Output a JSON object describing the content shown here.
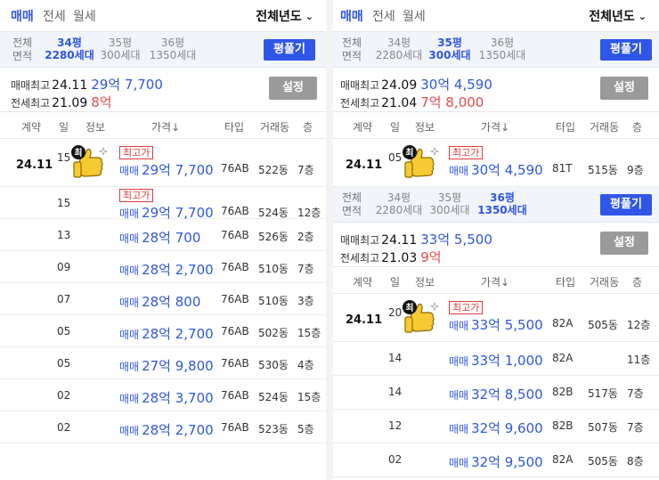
{
  "left": {
    "tabs": [
      "매매",
      "전세",
      "월세"
    ],
    "year_select": "전체년도",
    "size_labels": [
      "전체",
      "면적"
    ],
    "sizes": [
      {
        "pyeong": "34평",
        "units": "2280세대",
        "active": true
      },
      {
        "pyeong": "35평",
        "units": "300세대",
        "active": false
      },
      {
        "pyeong": "36평",
        "units": "1350세대",
        "active": false
      }
    ],
    "pyeong_button": "평풀기",
    "max_sale": {
      "label": "매매최고",
      "date": "24.11",
      "price": "29억 7,700"
    },
    "max_jeonse": {
      "label": "전세최고",
      "date": "21.09",
      "price": "8억"
    },
    "setting_button": "설정",
    "headers": [
      "계약",
      "일",
      "정보",
      "가격↓",
      "타입",
      "거래동",
      "층"
    ],
    "rows": [
      {
        "contract": "24.11",
        "day": "15",
        "badge": "최고가",
        "kind": "매매",
        "price": "29억 7,700",
        "type": "76AB",
        "dong": "522동",
        "floor": "7층"
      },
      {
        "contract": "",
        "day": "15",
        "badge": "최고가",
        "kind": "매매",
        "price": "29억 7,700",
        "type": "76AB",
        "dong": "524동",
        "floor": "12층"
      },
      {
        "contract": "",
        "day": "13",
        "badge": "",
        "kind": "매매",
        "price": "28억 700",
        "type": "76AB",
        "dong": "526동",
        "floor": "2층"
      },
      {
        "contract": "",
        "day": "09",
        "badge": "",
        "kind": "매매",
        "price": "28억 2,700",
        "type": "76AB",
        "dong": "510동",
        "floor": "7층"
      },
      {
        "contract": "",
        "day": "07",
        "badge": "",
        "kind": "매매",
        "price": "28억 800",
        "type": "76AB",
        "dong": "510동",
        "floor": "3층"
      },
      {
        "contract": "",
        "day": "05",
        "badge": "",
        "kind": "매매",
        "price": "28억 2,700",
        "type": "76AB",
        "dong": "502동",
        "floor": "15층"
      },
      {
        "contract": "",
        "day": "05",
        "badge": "",
        "kind": "매매",
        "price": "27억 9,800",
        "type": "76AB",
        "dong": "530동",
        "floor": "4층"
      },
      {
        "contract": "",
        "day": "02",
        "badge": "",
        "kind": "매매",
        "price": "28억 3,700",
        "type": "76AB",
        "dong": "524동",
        "floor": "15층"
      },
      {
        "contract": "",
        "day": "02",
        "badge": "",
        "kind": "매매",
        "price": "28억 2,700",
        "type": "76AB",
        "dong": "523동",
        "floor": "5층"
      }
    ]
  },
  "right": {
    "tabs": [
      "매매",
      "전세",
      "월세"
    ],
    "year_select": "전체년도",
    "top": {
      "size_labels": [
        "전체",
        "면적"
      ],
      "sizes": [
        {
          "pyeong": "34평",
          "units": "2280세대",
          "active": false
        },
        {
          "pyeong": "35평",
          "units": "300세대",
          "active": true
        },
        {
          "pyeong": "36평",
          "units": "1350세대",
          "active": false
        }
      ],
      "pyeong_button": "평풀기",
      "max_sale": {
        "label": "매매최고",
        "date": "24.09",
        "price": "30억 4,590"
      },
      "max_jeonse": {
        "label": "전세최고",
        "date": "21.04",
        "price": "7억 8,000"
      },
      "setting_button": "설정",
      "headers": [
        "계약",
        "일",
        "정보",
        "가격↓",
        "타입",
        "거래동",
        "층"
      ],
      "rows": [
        {
          "contract": "24.11",
          "day": "05",
          "badge": "최고가",
          "kind": "매매",
          "price": "30억 4,590",
          "type": "81T",
          "dong": "515동",
          "floor": "9층"
        }
      ]
    },
    "bottom": {
      "size_labels": [
        "전체",
        "면적"
      ],
      "sizes": [
        {
          "pyeong": "34평",
          "units": "2280세대",
          "active": false
        },
        {
          "pyeong": "35평",
          "units": "300세대",
          "active": false
        },
        {
          "pyeong": "36평",
          "units": "1350세대",
          "active": true
        }
      ],
      "pyeong_button": "평풀기",
      "max_sale": {
        "label": "매매최고",
        "date": "24.11",
        "price": "33억 5,500"
      },
      "max_jeonse": {
        "label": "전세최고",
        "date": "21.03",
        "price": "9억"
      },
      "setting_button": "설정",
      "headers": [
        "계약",
        "일",
        "정보",
        "가격↓",
        "타입",
        "거래동",
        "층"
      ],
      "rows": [
        {
          "contract": "24.11",
          "day": "20",
          "badge": "최고가",
          "kind": "매매",
          "price": "33억 5,500",
          "type": "82A",
          "dong": "505동",
          "floor": "12층"
        },
        {
          "contract": "",
          "day": "14",
          "badge": "",
          "kind": "매매",
          "price": "33억 1,000",
          "type": "82A",
          "dong": "",
          "floor": "11층"
        },
        {
          "contract": "",
          "day": "14",
          "badge": "",
          "kind": "매매",
          "price": "32억 8,500",
          "type": "82B",
          "dong": "517동",
          "floor": "7층"
        },
        {
          "contract": "",
          "day": "12",
          "badge": "",
          "kind": "매매",
          "price": "32억 9,600",
          "type": "82B",
          "dong": "507동",
          "floor": "7층"
        },
        {
          "contract": "",
          "day": "02",
          "badge": "",
          "kind": "매매",
          "price": "32억 9,500",
          "type": "82A",
          "dong": "505동",
          "floor": "8층"
        }
      ]
    }
  },
  "sticker": {
    "text": "최",
    "icon": "thumbs-up-sticker-icon"
  },
  "colors": {
    "accent": "#2f56e6",
    "red": "#e84b4b",
    "setting": "#9a9a9a",
    "size_bg": "#f2f4fb"
  }
}
